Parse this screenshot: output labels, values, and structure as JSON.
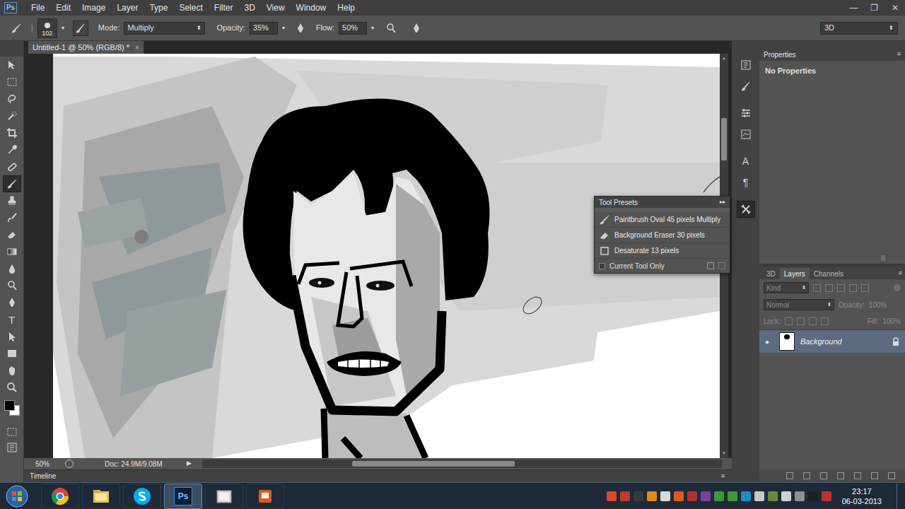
{
  "app": {
    "logo": "Ps"
  },
  "menu": [
    "File",
    "Edit",
    "Image",
    "Layer",
    "Type",
    "Select",
    "Filter",
    "3D",
    "View",
    "Window",
    "Help"
  ],
  "window_controls": [
    "—",
    "❐",
    "✕"
  ],
  "options_bar": {
    "brush_size": "102",
    "mode_label": "Mode:",
    "mode": "Multiply",
    "opacity_label": "Opacity:",
    "opacity": "35%",
    "flow_label": "Flow:",
    "flow": "50%",
    "workspace": "3D"
  },
  "document_tab": {
    "title": "Untitled-1 @ 50% (RGB/8) *",
    "close": "×"
  },
  "toolbar": {
    "tools": [
      {
        "kind": "move",
        "selected": false
      },
      {
        "kind": "marquee",
        "selected": false
      },
      {
        "kind": "lasso",
        "selected": false
      },
      {
        "kind": "quick-select",
        "selected": false
      },
      {
        "kind": "crop",
        "selected": false
      },
      {
        "kind": "eyedropper",
        "selected": false
      },
      {
        "kind": "healing",
        "selected": false
      },
      {
        "kind": "brush",
        "selected": true
      },
      {
        "kind": "stamp",
        "selected": false
      },
      {
        "kind": "history-brush",
        "selected": false
      },
      {
        "kind": "eraser",
        "selected": false
      },
      {
        "kind": "gradient",
        "selected": false
      },
      {
        "kind": "blur",
        "selected": false
      },
      {
        "kind": "dodge",
        "selected": false
      },
      {
        "kind": "pen",
        "selected": false
      },
      {
        "kind": "text",
        "glyph": "T",
        "selected": false
      },
      {
        "kind": "path-select",
        "selected": false
      },
      {
        "kind": "shape",
        "selected": false
      },
      {
        "kind": "hand",
        "selected": false
      },
      {
        "kind": "zoom",
        "selected": false
      }
    ],
    "foreground_color": "#000000",
    "background_color": "#ffffff"
  },
  "dock": [
    {
      "kind": "history",
      "selected": false
    },
    {
      "kind": "brush-presets",
      "selected": false
    },
    {
      "kind": "adjustments",
      "selected": false
    },
    {
      "kind": "styles",
      "selected": false
    },
    {
      "kind": "character",
      "glyph": "A",
      "selected": false
    },
    {
      "kind": "paragraph",
      "glyph": "¶",
      "selected": false
    },
    {
      "kind": "tool-presets",
      "selected": true
    }
  ],
  "tool_presets": {
    "title": "Tool Presets",
    "menu": "▸▸",
    "items": [
      {
        "label": "Paintbrush Oval 45 pixels Multiply",
        "kind": "brush",
        "selected": false
      },
      {
        "label": "Background Eraser 30 pixels",
        "kind": "eraser",
        "selected": false
      },
      {
        "label": "Desaturate 13 pixels",
        "kind": "sponge",
        "selected": false
      }
    ],
    "current_tool_only": {
      "label": "Current Tool Only",
      "checked": false
    }
  },
  "properties": {
    "title": "Properties",
    "message": "No Properties"
  },
  "layers_panel": {
    "tabs": [
      {
        "label": "3D",
        "selected": false
      },
      {
        "label": "Layers",
        "selected": true
      },
      {
        "label": "Channels",
        "selected": false
      }
    ],
    "filter": "Kind",
    "blend_mode": "Normal",
    "opacity_label": "Opacity:",
    "opacity": "100%",
    "lock_label": "Lock:",
    "fill_label": "Fill:",
    "fill": "100%",
    "controls_disabled": true,
    "layers": [
      {
        "name": "Background",
        "visible": true,
        "selected": true,
        "locked": true
      }
    ]
  },
  "status_bar": {
    "zoom": "50%",
    "doc": "Doc: 24.9M/9.08M",
    "arrow": "▶"
  },
  "timeline": {
    "label": "Timeline"
  },
  "taskbar": {
    "apps": [
      {
        "kind": "chrome",
        "selected": false
      },
      {
        "kind": "explorer",
        "selected": false
      },
      {
        "kind": "skype",
        "selected": false
      },
      {
        "kind": "photoshop",
        "glyph": "Ps",
        "selected": true
      },
      {
        "kind": "folder",
        "selected": false
      },
      {
        "kind": "presentation",
        "selected": false
      }
    ],
    "tray": [
      {
        "color": "#d94a2b"
      },
      {
        "color": "#c0392b"
      },
      {
        "color": "#3a3a3a"
      },
      {
        "color": "#e08a1e"
      },
      {
        "color": "#d9d9d9"
      },
      {
        "color": "#e05a20"
      },
      {
        "color": "#b03030"
      },
      {
        "color": "#7a3fa0"
      },
      {
        "color": "#3b9a3b"
      },
      {
        "color": "#3b9a3b"
      },
      {
        "color": "#1f8ac0"
      },
      {
        "color": "#c8c8c8"
      },
      {
        "color": "#6a8a3a"
      },
      {
        "color": "#d0d0d0"
      },
      {
        "color": "#909090"
      },
      {
        "color": "#202020"
      },
      {
        "color": "#c03030"
      }
    ],
    "time": "23:17",
    "date": "06-03-2013"
  }
}
